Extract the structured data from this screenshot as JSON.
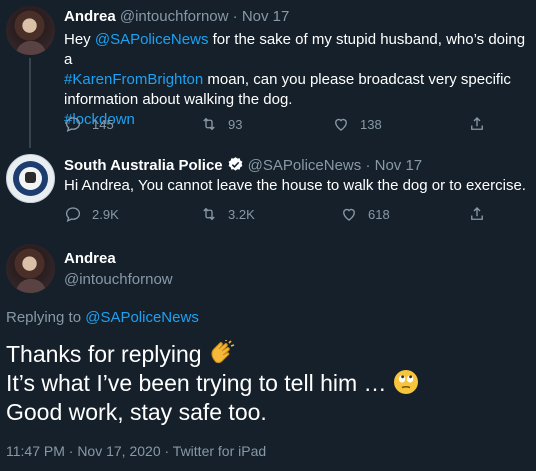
{
  "tweet1": {
    "name": "Andrea",
    "handle": "@intouchfornow",
    "sep": "·",
    "date": "Nov 17",
    "text": {
      "hey": "Hey ",
      "mention": "@SAPoliceNews",
      "part1": " for the sake of my stupid husband, who’s doing a",
      "hashtag": "#KarenFromBrighton",
      "part2": " moan, can you please broadcast very specific",
      "line3": "information about walking the dog.",
      "hashtag2": "#lockdown"
    },
    "replies": "145",
    "retweets": "93",
    "likes": "138"
  },
  "tweet2": {
    "name": "South Australia Police",
    "handle": "@SAPoliceNews",
    "sep": "·",
    "date": "Nov 17",
    "text": "Hi Andrea, You cannot leave the house to walk the dog or to exercise.",
    "replies": "2.9K",
    "retweets": "3.2K",
    "likes": "618"
  },
  "main": {
    "name": "Andrea",
    "handle": "@intouchfornow",
    "replying_to_label": "Replying to ",
    "replying_to_handle": "@SAPoliceNews",
    "line1": "Thanks for replying ",
    "line2": "It’s what I’ve been trying to tell him … ",
    "line3": "Good work, stay safe too.",
    "timestamp": "11:47 PM · Nov 17, 2020 · Twitter for iPad"
  },
  "icons": {
    "reply": "reply-icon",
    "retweet": "retweet-icon",
    "like": "heart-icon",
    "share": "share-icon",
    "verified": "verified-badge-icon",
    "clap": "clapping-hands-emoji",
    "eyeroll": "eye-roll-emoji"
  },
  "colors": {
    "background": "#15202b",
    "accent": "#1da1f2",
    "muted": "#8899a6",
    "border": "#38444d"
  }
}
